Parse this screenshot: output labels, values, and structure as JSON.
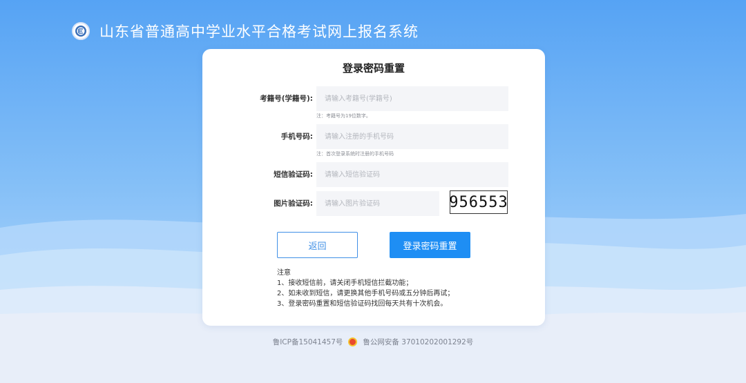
{
  "header": {
    "title": "山东省普通高中学业水平合格考试网上报名系统",
    "logo_icon": "exam-emblem-icon"
  },
  "card": {
    "title": "登录密码重置",
    "fields": {
      "exam_no": {
        "label": "考籍号(学籍号):",
        "placeholder": "请输入考籍号(学籍号)",
        "hint": "注：考籍号为19位数字。"
      },
      "phone": {
        "label": "手机号码:",
        "placeholder": "请输入注册的手机号码",
        "hint": "注：首次登录系统时注册的手机号码"
      },
      "sms_code": {
        "label": "短信验证码:",
        "placeholder": "请输入短信验证码"
      },
      "image_code": {
        "label": "图片验证码:",
        "placeholder": "请输入图片验证码",
        "captcha_text": "956553"
      }
    },
    "buttons": {
      "back": "返回",
      "reset": "登录密码重置"
    },
    "notes": {
      "title": "注意",
      "items": [
        "1、接收短信前，请关闭手机短信拦截功能；",
        "2、如未收到短信，请更换其他手机号码或五分钟后再试；",
        "3、登录密码重置和短信验证码找回每天共有十次机会。"
      ]
    }
  },
  "footer": {
    "icp": "鲁ICP备15041457号",
    "police": "鲁公网安备 37010202001292号"
  },
  "colors": {
    "primary": "#1e8ef4",
    "sky_top": "#5aa6f5"
  }
}
